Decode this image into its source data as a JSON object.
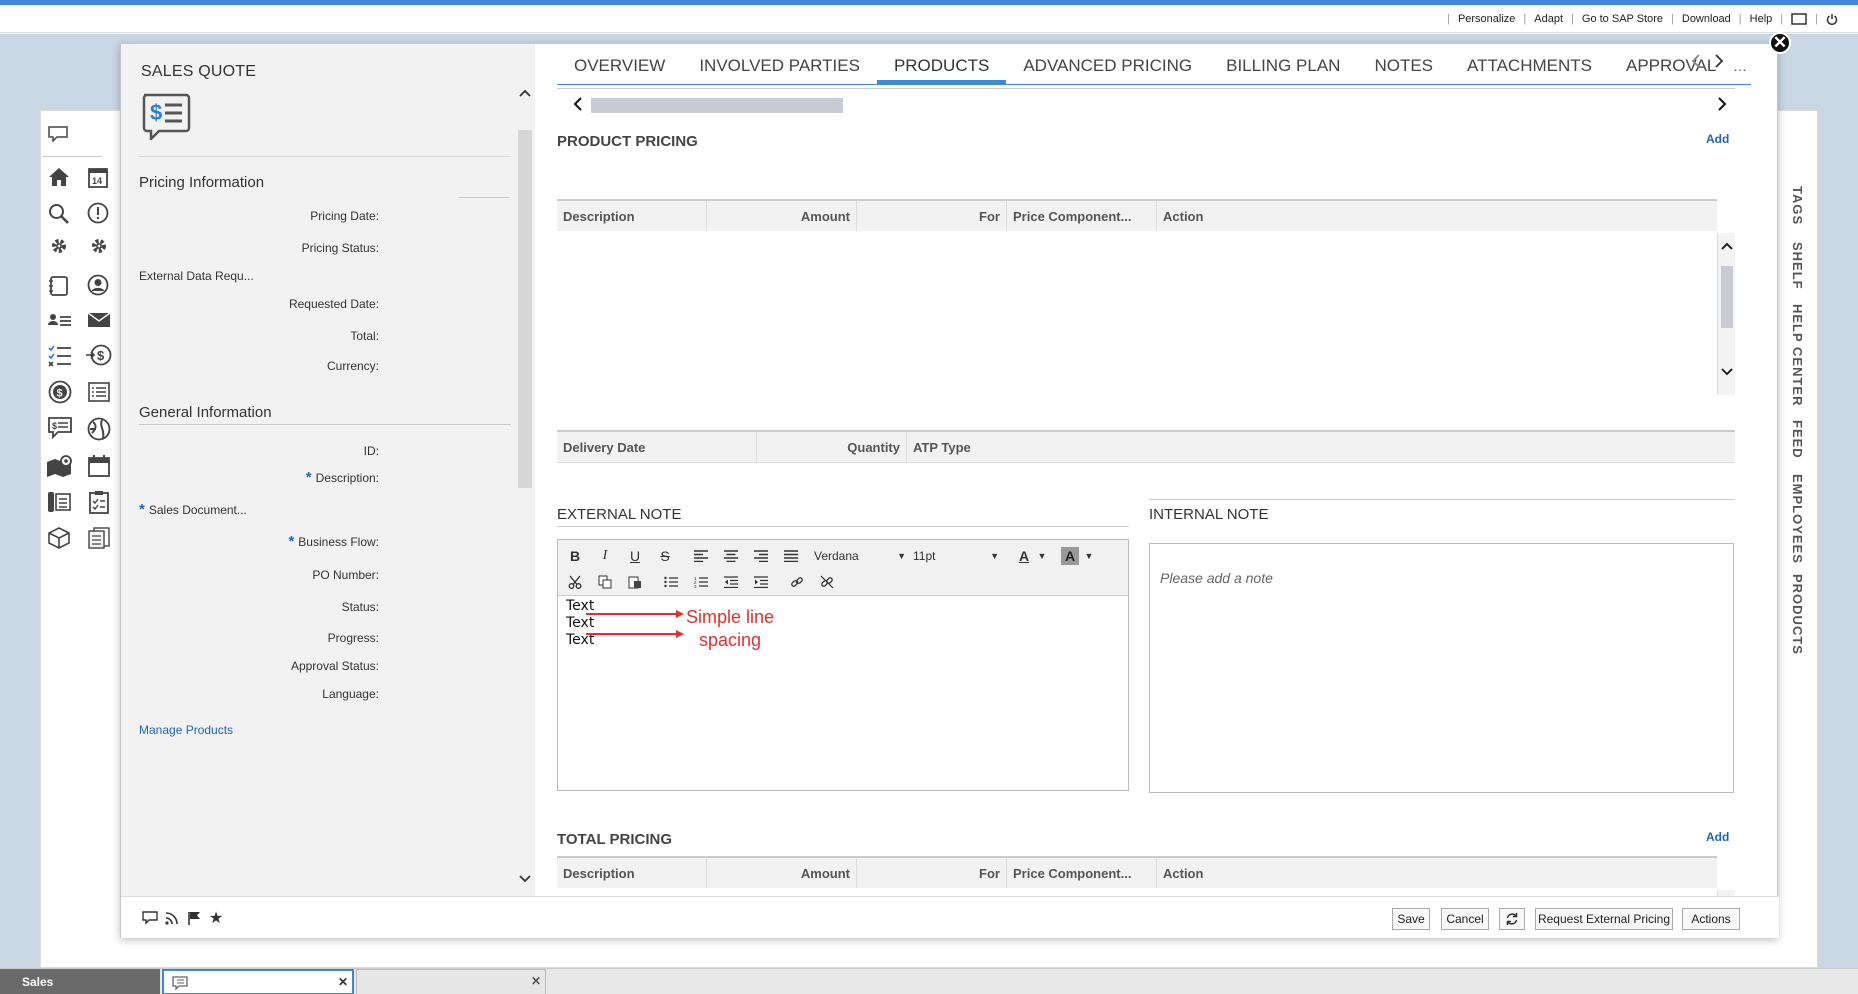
{
  "topbar": {
    "links": [
      "Personalize",
      "Adapt",
      "Go to SAP Store",
      "Download",
      "Help"
    ]
  },
  "left": {
    "object_title": "SALES QUOTE",
    "pricing_section": "Pricing Information",
    "pricing_fields": [
      "Pricing Date:",
      "Pricing Status:",
      "External Data Requ...",
      "Requested Date:",
      "Total:",
      "Currency:"
    ],
    "general_section": "General Information",
    "general_fields": {
      "id": "ID:",
      "description": "Description:",
      "sales_document": "Sales Document...",
      "business_flow": "Business Flow:",
      "po_number": "PO Number:",
      "status": "Status:",
      "progress": "Progress:",
      "approval_status": "Approval Status:",
      "language": "Language:"
    },
    "manage_products": "Manage Products"
  },
  "tabs": [
    "OVERVIEW",
    "INVOLVED PARTIES",
    "PRODUCTS",
    "ADVANCED PRICING",
    "BILLING PLAN",
    "NOTES",
    "ATTACHMENTS",
    "APPROVAL"
  ],
  "active_tab": "PRODUCTS",
  "product_pricing": {
    "title": "PRODUCT PRICING",
    "add": "Add",
    "columns": [
      "Description",
      "Amount",
      "For",
      "Price Component...",
      "Action"
    ]
  },
  "schedule": {
    "columns": [
      "Delivery Date",
      "Quantity",
      "ATP Type"
    ]
  },
  "external_note": {
    "title": "EXTERNAL NOTE",
    "font": "Verdana",
    "size": "11pt",
    "lines": [
      "Text",
      "Text",
      "Text"
    ],
    "annotation_line1": "Simple line",
    "annotation_line2": "spacing"
  },
  "internal_note": {
    "title": "INTERNAL NOTE",
    "placeholder": "Please add a note"
  },
  "total_pricing": {
    "title": "TOTAL PRICING",
    "add": "Add",
    "columns": [
      "Description",
      "Amount",
      "For",
      "Price Component...",
      "Action"
    ]
  },
  "footer": {
    "save": "Save",
    "cancel": "Cancel",
    "request_external_pricing": "Request External Pricing",
    "actions": "Actions"
  },
  "side_panel": [
    "TAGS",
    "SHELF",
    "HELP CENTER",
    "FEED",
    "EMPLOYEES",
    "PRODUCTS"
  ],
  "taskbar": {
    "sales": "Sales"
  },
  "colors": {
    "accent": "#3f87d9",
    "link": "#1f66b3",
    "annotation": "#e03030"
  }
}
